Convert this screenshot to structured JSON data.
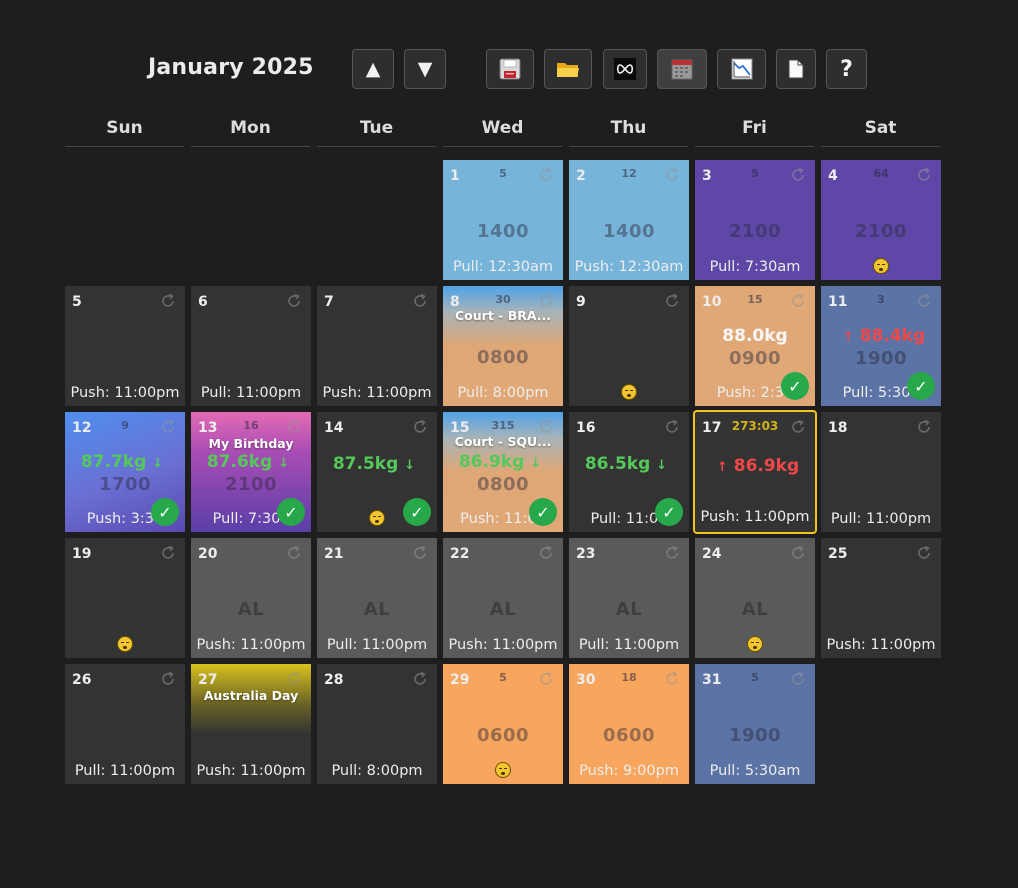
{
  "header": {
    "month_title": "January 2025",
    "buttons": [
      {
        "name": "prev-month-button",
        "icon": "up-arrow-icon",
        "glyph": "▲"
      },
      {
        "name": "next-month-button",
        "icon": "down-arrow-icon",
        "glyph": "▼"
      },
      {
        "name": "save-button",
        "icon": "floppy-disk-icon"
      },
      {
        "name": "open-button",
        "icon": "folder-icon"
      },
      {
        "name": "link-button",
        "icon": "infinity-icon"
      },
      {
        "name": "calendar-view-button",
        "icon": "calendar-icon"
      },
      {
        "name": "chart-button",
        "icon": "chart-icon"
      },
      {
        "name": "document-button",
        "icon": "document-icon"
      },
      {
        "name": "help-button",
        "icon": "help-icon",
        "glyph": "?"
      }
    ]
  },
  "weekdays": [
    "Sun",
    "Mon",
    "Tue",
    "Wed",
    "Thu",
    "Fri",
    "Sat"
  ],
  "colors": {
    "background": "#1e1e1e",
    "cell_default": "#333333",
    "light_blue": "#77b4d9",
    "purple": "#5e47a6",
    "gray": "#5a5a5a",
    "orange": "#f8a55e",
    "slate": "#5b73a5",
    "selected_border": "#f0c419",
    "check_green": "#27a84a",
    "weight_down": "#55c85a",
    "weight_up": "#f04848"
  },
  "days": [
    {
      "day": "1",
      "counter": "5",
      "value": "1400",
      "bottom": "Pull: 12:30am"
    },
    {
      "day": "2",
      "counter": "12",
      "value": "1400",
      "bottom": "Push: 12:30am"
    },
    {
      "day": "3",
      "counter": "5",
      "value": "2100",
      "bottom": "Pull: 7:30am"
    },
    {
      "day": "4",
      "counter": "64",
      "value": "2100",
      "sleep": true
    },
    {
      "day": "5",
      "bottom": "Push: 11:00pm"
    },
    {
      "day": "6",
      "bottom": "Pull: 11:00pm"
    },
    {
      "day": "7",
      "bottom": "Push: 11:00pm"
    },
    {
      "day": "8",
      "counter": "30",
      "event": "Court - BRA...",
      "value": "0800",
      "bottom": "Pull: 8:00pm"
    },
    {
      "day": "9",
      "sleep": true
    },
    {
      "day": "10",
      "counter": "15",
      "weight": "88.0kg",
      "value": "0900",
      "bottom": "Push: 2:30",
      "check": true
    },
    {
      "day": "11",
      "counter": "3",
      "weight": "88.4kg",
      "weight_dir": "up",
      "value": "1900",
      "bottom": "Pull: 5:30a",
      "check": true
    },
    {
      "day": "12",
      "counter": "9",
      "weight": "87.7kg",
      "weight_dir": "down",
      "value": "1700",
      "bottom": "Push: 3:30",
      "check": true
    },
    {
      "day": "13",
      "counter": "16",
      "event": "My Birthday",
      "weight": "87.6kg",
      "weight_dir": "down",
      "value": "2100",
      "bottom": "Pull: 7:30a",
      "check": true
    },
    {
      "day": "14",
      "weight": "87.5kg",
      "weight_dir": "down",
      "sleep": true,
      "check": true
    },
    {
      "day": "15",
      "counter": "315",
      "event": "Court - SQU...",
      "weight": "86.9kg",
      "weight_dir": "down",
      "value": "0800",
      "bottom": "Push: 11:00",
      "check": true
    },
    {
      "day": "16",
      "weight": "86.5kg",
      "weight_dir": "down",
      "bottom": "Pull: 11:00",
      "check": true
    },
    {
      "day": "17",
      "counter": "273:03",
      "weight": "86.9kg",
      "weight_dir": "up",
      "bottom": "Push: 11:00pm",
      "selected": true
    },
    {
      "day": "18",
      "bottom": "Pull: 11:00pm"
    },
    {
      "day": "19",
      "sleep": true
    },
    {
      "day": "20",
      "value": "AL",
      "bottom": "Push: 11:00pm"
    },
    {
      "day": "21",
      "value": "AL",
      "bottom": "Pull: 11:00pm"
    },
    {
      "day": "22",
      "value": "AL",
      "bottom": "Push: 11:00pm"
    },
    {
      "day": "23",
      "value": "AL",
      "bottom": "Pull: 11:00pm"
    },
    {
      "day": "24",
      "value": "AL",
      "sleep": true
    },
    {
      "day": "25",
      "bottom": "Push: 11:00pm"
    },
    {
      "day": "26",
      "bottom": "Pull: 11:00pm"
    },
    {
      "day": "27",
      "event": "Australia Day",
      "bottom": "Push: 11:00pm"
    },
    {
      "day": "28",
      "bottom": "Pull: 8:00pm"
    },
    {
      "day": "29",
      "counter": "5",
      "value": "0600",
      "sleep": true
    },
    {
      "day": "30",
      "counter": "18",
      "value": "0600",
      "bottom": "Push: 9:00pm"
    },
    {
      "day": "31",
      "counter": "5",
      "value": "1900",
      "bottom": "Pull: 5:30am"
    }
  ]
}
